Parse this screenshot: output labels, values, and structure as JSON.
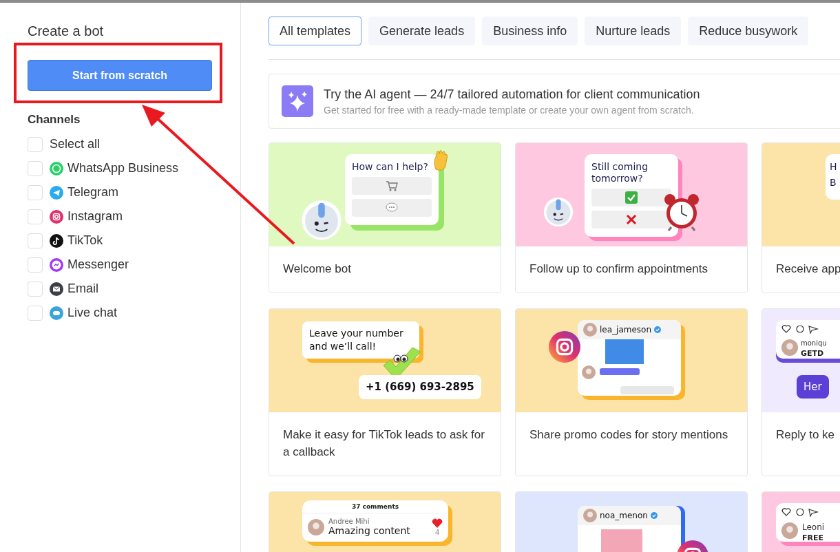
{
  "sidebar": {
    "title": "Create a bot",
    "primary_button": "Start from scratch",
    "channels_heading": "Channels",
    "channels": [
      {
        "label": "Select all",
        "kind": "all",
        "checked": false
      },
      {
        "label": "WhatsApp Business",
        "kind": "whatsapp",
        "checked": false
      },
      {
        "label": "Telegram",
        "kind": "telegram",
        "checked": false
      },
      {
        "label": "Instagram",
        "kind": "instagram",
        "checked": false
      },
      {
        "label": "TikTok",
        "kind": "tiktok",
        "checked": false
      },
      {
        "label": "Messenger",
        "kind": "messenger",
        "checked": false
      },
      {
        "label": "Email",
        "kind": "email",
        "checked": false
      },
      {
        "label": "Live chat",
        "kind": "livechat",
        "checked": false
      }
    ]
  },
  "tabs": [
    {
      "label": "All templates",
      "selected": true
    },
    {
      "label": "Generate leads",
      "selected": false
    },
    {
      "label": "Business info",
      "selected": false
    },
    {
      "label": "Nurture leads",
      "selected": false
    },
    {
      "label": "Reduce busywork",
      "selected": false
    }
  ],
  "banner": {
    "title": "Try the AI agent — 24/7 tailored automation for client communication",
    "subtitle": "Get started for free with a ready-made template or create your own agent from scratch."
  },
  "templates": [
    {
      "title": "Welcome bot",
      "kind": "welcome",
      "color": "#dff9c0",
      "lines": [
        "How can I help?"
      ]
    },
    {
      "title": "Follow up to confirm appointments",
      "kind": "confirm",
      "color": "#fdc8e0",
      "lines": [
        "Still coming tomorrow?"
      ]
    },
    {
      "title": "Receive app",
      "kind": "partial",
      "color": "#fce3a8",
      "lines": [
        "H",
        "B"
      ]
    },
    {
      "title": "Make it easy for TikTok leads to ask for a callback",
      "kind": "callback",
      "color": "#fce3a8",
      "lines": [
        "Leave your number and we’ll call!",
        "+1 (669) 693-2895"
      ]
    },
    {
      "title": "Share promo codes for story mentions",
      "kind": "promo",
      "color": "#fce3a8",
      "lines": [
        "lea_jameson"
      ]
    },
    {
      "title": "Reply to ke",
      "kind": "reply",
      "color": "#efeafd",
      "lines": [
        "moniqu",
        "GETD",
        "Her"
      ]
    },
    {
      "kind": "comments",
      "color": "#fce3a8",
      "lines": [
        "37 comments",
        "Andree Mihi",
        "Amazing content",
        "4"
      ]
    },
    {
      "kind": "story",
      "color": "#dde6fd",
      "lines": [
        "noa_menon"
      ]
    },
    {
      "kind": "offer",
      "color": "#fdc8e0",
      "lines": [
        "Leoni",
        "FREE"
      ]
    }
  ]
}
